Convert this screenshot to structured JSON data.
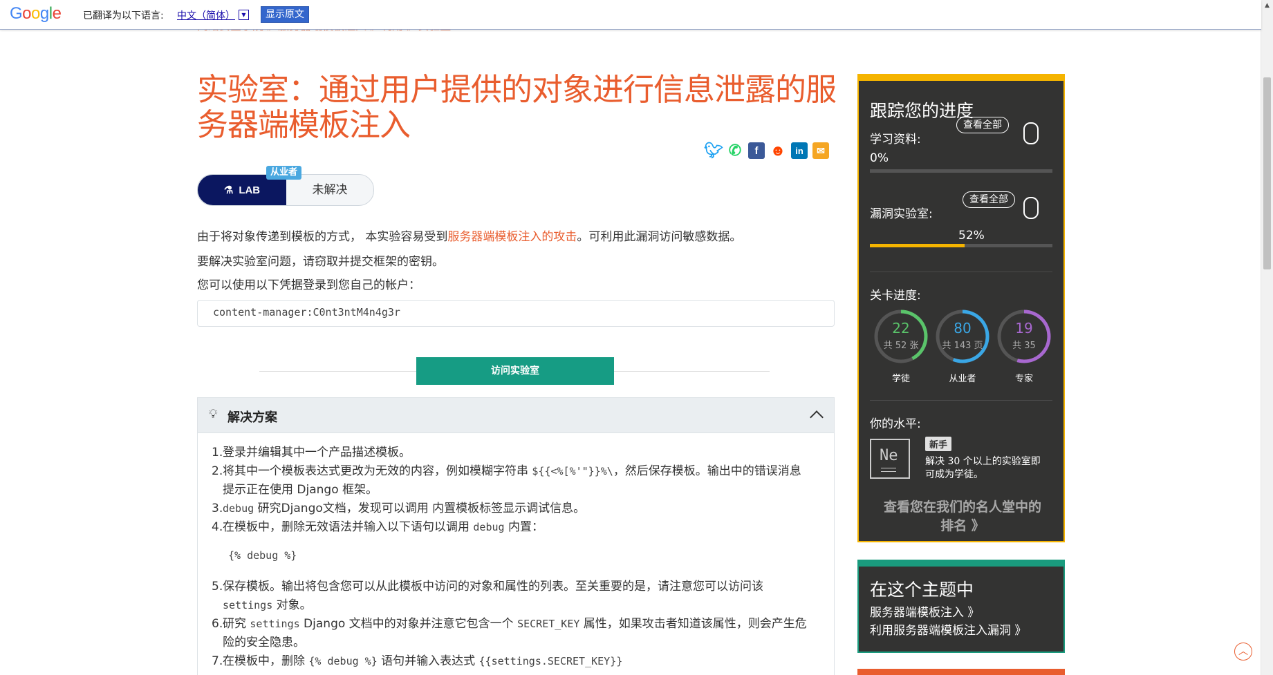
{
  "translate_bar": {
    "logo": "Google",
    "label": "已翻译为以下语言:",
    "language": "中文（简体）",
    "dropdown": "▼",
    "show_original": "显示原文"
  },
  "breadcrumb": "网络安全学院 》服务器端模板注入 》利用 》实验室",
  "title": "实验室：通过用户提供的对象进行信息泄露的服务器端模板注入",
  "share_icons": [
    "twitter-icon",
    "whatsapp-icon",
    "facebook-icon",
    "reddit-icon",
    "linkedin-icon",
    "email-icon"
  ],
  "lab_badge": {
    "type": "LAB",
    "status": "未解决",
    "level": "从业者"
  },
  "description": {
    "p1_before": "由于将对象传递到模板的方式， 本实验容易受到",
    "p1_link": "服务器端模板注入的攻击",
    "p1_after": "。可利用此漏洞访问敏感数据。",
    "p2": "要解决实验室问题，请窃取并提交框架的密钥。",
    "p3": "您可以使用以下凭据登录到您自己的帐户："
  },
  "credentials": "content-manager:C0nt3ntM4n4g3r",
  "access_button": "访问实验室",
  "solution": {
    "title": "解决方案",
    "steps": [
      {
        "n": "1.",
        "text": "登录并编辑其中一个产品描述模板。"
      },
      {
        "n": "2.",
        "a": "将其中一个模板表达式更改为无效的内容，例如模糊字符串 ",
        "code": "${{<%[%'\"}}%\\",
        "b": "，然后保存模板。输出中的错误消息提示正在使用 Django 框架。"
      },
      {
        "n": "3.",
        "code": "debug",
        "b": " 研究Django文档，发现可以调用 内置模板标签显示调试信息。"
      },
      {
        "n": "4.",
        "a": "在模板中，删除无效语法并输入以下语句以调用 ",
        "code": "debug",
        "b": " 内置："
      }
    ],
    "code_block": "{% debug %}",
    "steps2": [
      {
        "n": "5.",
        "a": "保存模板。输出将包含您可以从此模板中访问的对象和属性的列表。至关重要的是，请注意您可以访问该 ",
        "code": "settings",
        "b": " 对象。"
      },
      {
        "n": "6.",
        "a": "研究 ",
        "code": "settings",
        "b": " Django 文档中的对象并注意它包含一个 ",
        "code2": "SECRET_KEY",
        "c": " 属性，如果攻击者知道该属性，则会产生危险的安全隐患。"
      },
      {
        "n": "7.",
        "a": "在模板中，删除 ",
        "code": "{% debug %}",
        "b": " 语句并输入表达式 ",
        "code2": "{{settings.SECRET_KEY}}",
        "c": ""
      }
    ]
  },
  "progress": {
    "title": "跟踪您的进度",
    "view_all": "查看全部",
    "learning_label": "学习资料:",
    "learning_pct": "0%",
    "learning_value": 0,
    "labs_label": "漏洞实验室:",
    "labs_pct": "52%",
    "labs_value": 52,
    "level_label": "关卡进度:",
    "rings": [
      {
        "num": "22",
        "sub": "共 52 张",
        "label": "学徒",
        "done": 22,
        "total": 52,
        "color": "#5ac46a"
      },
      {
        "num": "80",
        "sub": "共 143 页",
        "label": "从业者",
        "done": 80,
        "total": 143,
        "color": "#3aa7e6"
      },
      {
        "num": "19",
        "sub": "共 35",
        "label": "专家",
        "done": 19,
        "total": 35,
        "color": "#a868d0"
      }
    ],
    "your_level": "你的水平:",
    "element_symbol": "Ne",
    "novice_badge": "新手",
    "novice_desc": "解决 30 个以上的实验室即可成为学徒。",
    "hall_of_fame": "查看您在我们的名人堂中的排名 》"
  },
  "topic": {
    "title": "在这个主题中",
    "items": [
      "服务器端模板注入 》",
      "利用服务器端模板注入漏洞 》"
    ]
  }
}
